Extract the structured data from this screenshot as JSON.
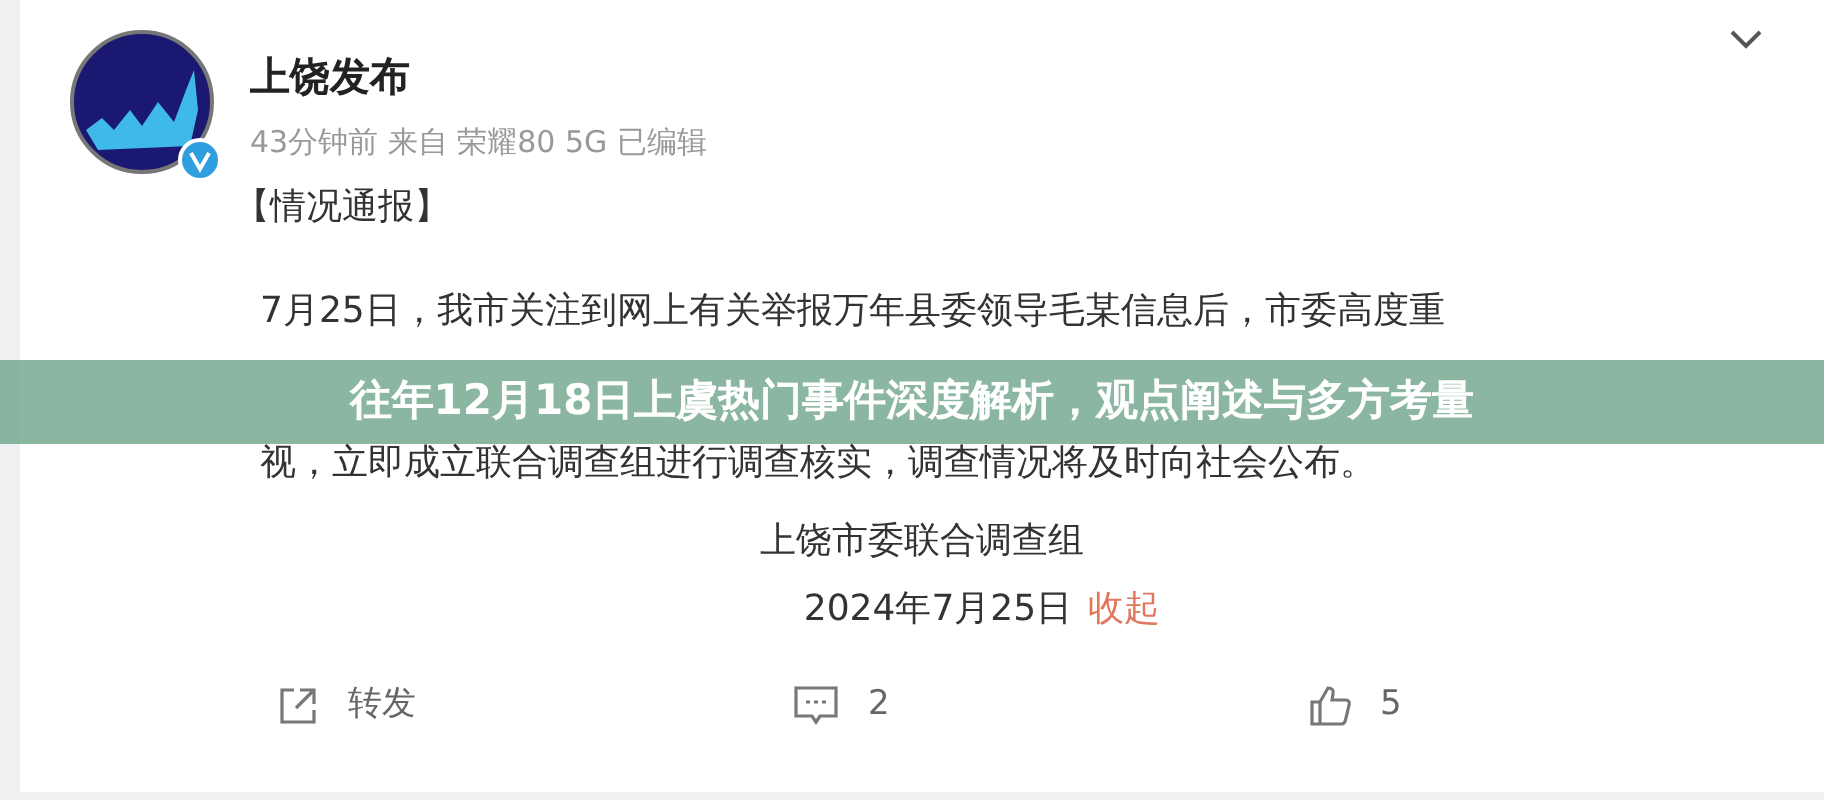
{
  "post": {
    "author": "上饶发布",
    "verified": true,
    "meta": "43分钟前 来自 荣耀80 5G 已编辑",
    "heading": "【情况通报】",
    "body_lines": [
      "7月25日，我市关注到网上有关举报万年县委领导毛某信息后，市委高度重",
      "视，立即成立联合调查组进行调查核实，调查情况将及时向社会公布。"
    ],
    "signature": "上饶市委联合调查组",
    "date": "2024年7月25日",
    "collapse_link": "收起"
  },
  "actions": [
    {
      "kind": "repost",
      "label": "转发"
    },
    {
      "kind": "comment",
      "label": "2"
    },
    {
      "kind": "like",
      "label": "5"
    }
  ],
  "banner": {
    "title": "往年12月18日上虞热门事件深度解析，观点阐述与多方考量"
  }
}
